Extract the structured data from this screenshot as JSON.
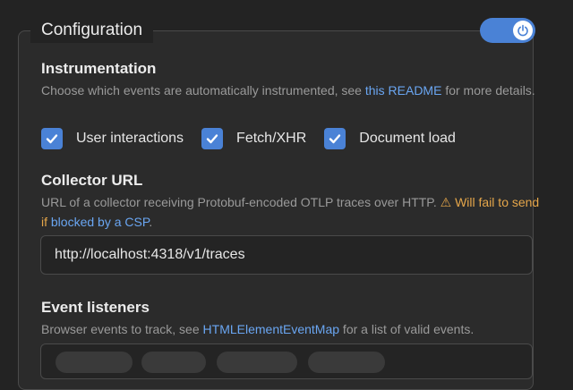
{
  "panel": {
    "legend": "Configuration",
    "enabled": true
  },
  "instrumentation": {
    "title": "Instrumentation",
    "desc_before": "Choose which events are automatically instrumented, see ",
    "desc_link": "this README",
    "desc_after": " for more details.",
    "options": [
      {
        "label": "User interactions",
        "checked": true
      },
      {
        "label": "Fetch/XHR",
        "checked": true
      },
      {
        "label": "Document load",
        "checked": true
      }
    ]
  },
  "collector": {
    "title": "Collector URL",
    "desc_before": "URL of a collector receiving Protobuf-encoded OTLP traces over HTTP. ",
    "warning_icon": "⚠",
    "warning_text": " Will fail to send if ",
    "warning_link": "blocked by a CSP",
    "warning_after": ".",
    "value": "http://localhost:4318/v1/traces"
  },
  "listeners": {
    "title": "Event listeners",
    "desc_before": "Browser events to track, see ",
    "desc_link": "HTMLElementEventMap",
    "desc_after": " for a list of valid events."
  },
  "colors": {
    "accent": "#4a82d6",
    "link": "#6aa6f2",
    "warning": "#e5a64a"
  }
}
